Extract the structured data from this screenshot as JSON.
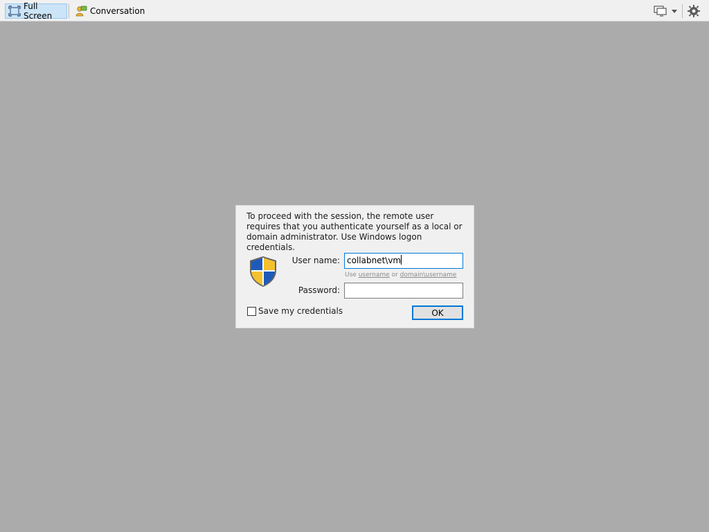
{
  "toolbar": {
    "fullscreen_label": "Full Screen",
    "conversation_label": "Conversation"
  },
  "dialog": {
    "message": "To proceed with the session, the remote user requires that you authenticate yourself as a local or domain administrator. Use Windows logon credentials.",
    "username_label": "User name:",
    "username_value": "collabnet\\vm",
    "hint_use": "Use",
    "hint_username": "username",
    "hint_or": "or",
    "hint_domain_username": "domain\\username",
    "password_label": "Password:",
    "password_value": "",
    "save_credentials_label": "Save my credentials",
    "save_credentials_checked": false,
    "ok_label": "OK"
  },
  "colors": {
    "background": "#ababab",
    "accent": "#0078d7",
    "shield_blue": "#1e5bb8",
    "shield_yellow": "#f6c12e"
  }
}
